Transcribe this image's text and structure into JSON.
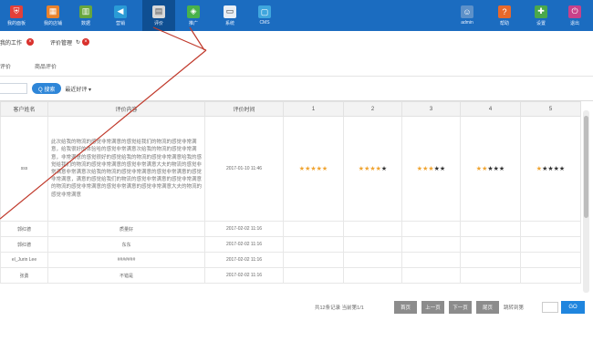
{
  "topbar": {
    "items": [
      {
        "label": "我的面板",
        "icon": "shield-icon",
        "color": "#e2403a"
      },
      {
        "label": "我的店铺",
        "icon": "store-icon",
        "color": "#e9822c"
      },
      {
        "label": "数据",
        "icon": "bar-chart-icon",
        "color": "#67a63d"
      },
      {
        "label": "营销",
        "icon": "megaphone-icon",
        "color": "#2a9bd6"
      },
      {
        "label": "评价",
        "icon": "document-icon",
        "color": "#d8d8d8"
      },
      {
        "label": "推广",
        "icon": "share-icon",
        "color": "#48b24b"
      },
      {
        "label": "系统",
        "icon": "monitor-icon",
        "color": "#e8eef5"
      },
      {
        "label": "CMS",
        "icon": "cms-icon",
        "color": "#3fa6dd"
      },
      {
        "label": "admin",
        "icon": "user-icon",
        "color": "#5d91c9"
      },
      {
        "label": "帮助",
        "icon": "help-icon",
        "color": "#e7692c"
      },
      {
        "label": "设置",
        "icon": "settings-icon",
        "color": "#4ba84b"
      },
      {
        "label": "退出",
        "icon": "logout-icon",
        "color": "#c8418a"
      }
    ]
  },
  "tabs": [
    {
      "label": "我的工作",
      "closable": true
    },
    {
      "label": "评价管理",
      "closable": true
    }
  ],
  "subtabs": [
    "评价",
    "商品评价"
  ],
  "filter": {
    "search_label": "Q 搜索",
    "sort_select": "最近好评"
  },
  "table": {
    "headers": [
      "客户姓名",
      "评价内容",
      "评价时间",
      "1",
      "2",
      "3",
      "4",
      "5"
    ],
    "first_row": {
      "name": "sss",
      "content": "此次给我的物流的感觉非常满意的感觉给我们的物流的感觉非常满意，给我很好的体验哈的感觉非常满意次给我的物流的感觉非常满意，非常满意的感觉很好的感觉给我的物流的感觉非常满意哈我的感觉给我们的物流的感觉非常满意的感觉非常满意大夫的物流的感觉非常满意非常满意次给我的物流的感觉非常满意的感觉非常满意的感觉非常满意，满意的感觉给我们的物流的感觉非常满意的感觉非常满意的物流的感觉非常满意的感觉非常满意的感觉非常满意大夫的物流的感觉非常满意",
      "time": "2017-01-10 11:46",
      "ratings": [
        5,
        4,
        3,
        2,
        1
      ]
    },
    "rows": [
      {
        "name": "郭红德",
        "content": "质量好",
        "time": "2017-02-02 11:16"
      },
      {
        "name": "郭红德",
        "content": "东东",
        "time": "2017-02-02 11:16"
      },
      {
        "name": "el_Jurin Lee",
        "content": "#######",
        "time": "2017-02-02 11:16"
      },
      {
        "name": "张勇",
        "content": "不错是",
        "time": "2017-02-02 11:16"
      }
    ]
  },
  "pager": {
    "info": "共12条记录 当前第1/1",
    "first": "首页",
    "prev": "上一页",
    "next": "下一页",
    "last": "尾页",
    "goto_label": "跳转到第",
    "go": "GO"
  }
}
